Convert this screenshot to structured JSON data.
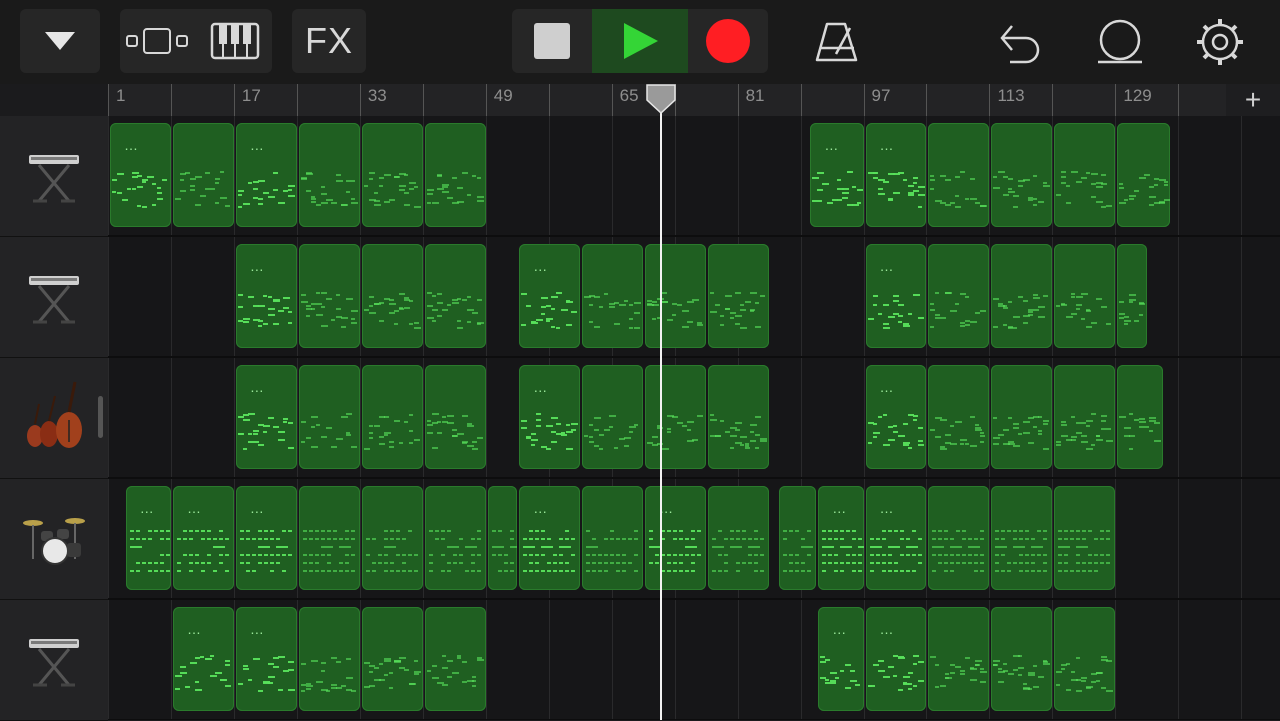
{
  "toolbar": {
    "tracks_menu_icon": "triangle-down-icon",
    "view_toggle_icon": "tracks-view-icon",
    "instrument_icon": "piano-keyboard-icon",
    "fx_label": "FX",
    "transport": {
      "stop_icon": "stop-icon",
      "play_icon": "play-icon",
      "record_icon": "record-icon"
    },
    "metronome_icon": "metronome-icon",
    "undo_icon": "undo-icon",
    "loop_icon": "loop-browser-icon",
    "settings_icon": "settings-gear-icon"
  },
  "ruler": {
    "labels": [
      "1",
      "17",
      "33",
      "49",
      "65",
      "81",
      "97",
      "113",
      "129"
    ],
    "add_label": "+"
  },
  "playhead_bar": 71,
  "colors": {
    "region": "#1f5f21",
    "note": "#59e25c",
    "accent_play": "#34d536",
    "record": "#ff1e23"
  },
  "tracks": [
    {
      "name": "keyboard",
      "icon": "keyboard-stand-icon",
      "regions": [
        {
          "label": "…",
          "start": 1,
          "end": 9
        },
        {
          "label": "",
          "start": 9,
          "end": 17
        },
        {
          "label": "…",
          "start": 17,
          "end": 25
        },
        {
          "label": "",
          "start": 25,
          "end": 33
        },
        {
          "label": "",
          "start": 33,
          "end": 41
        },
        {
          "label": "",
          "start": 41,
          "end": 49
        },
        {
          "label": "…",
          "start": 90,
          "end": 97
        },
        {
          "label": "…",
          "start": 97,
          "end": 105
        },
        {
          "label": "",
          "start": 105,
          "end": 113
        },
        {
          "label": "",
          "start": 113,
          "end": 121
        },
        {
          "label": "",
          "start": 121,
          "end": 129
        },
        {
          "label": "",
          "start": 129,
          "end": 136
        }
      ]
    },
    {
      "name": "keyboard-2",
      "icon": "keyboard-stand-icon",
      "regions": [
        {
          "label": "…",
          "start": 17,
          "end": 25
        },
        {
          "label": "",
          "start": 25,
          "end": 33
        },
        {
          "label": "",
          "start": 33,
          "end": 41
        },
        {
          "label": "",
          "start": 41,
          "end": 49
        },
        {
          "label": "…",
          "start": 53,
          "end": 61
        },
        {
          "label": "",
          "start": 61,
          "end": 69
        },
        {
          "label": "",
          "start": 69,
          "end": 77
        },
        {
          "label": "",
          "start": 77,
          "end": 85
        },
        {
          "label": "…",
          "start": 97,
          "end": 105
        },
        {
          "label": "",
          "start": 105,
          "end": 113
        },
        {
          "label": "",
          "start": 113,
          "end": 121
        },
        {
          "label": "",
          "start": 121,
          "end": 129
        },
        {
          "label": "",
          "start": 129,
          "end": 133
        }
      ]
    },
    {
      "name": "strings",
      "icon": "string-ensemble-icon",
      "regions": [
        {
          "label": "…",
          "start": 17,
          "end": 25
        },
        {
          "label": "",
          "start": 25,
          "end": 33
        },
        {
          "label": "",
          "start": 33,
          "end": 41
        },
        {
          "label": "",
          "start": 41,
          "end": 49
        },
        {
          "label": "…",
          "start": 53,
          "end": 61
        },
        {
          "label": "",
          "start": 61,
          "end": 69
        },
        {
          "label": "",
          "start": 69,
          "end": 77
        },
        {
          "label": "",
          "start": 77,
          "end": 85
        },
        {
          "label": "…",
          "start": 97,
          "end": 105
        },
        {
          "label": "",
          "start": 105,
          "end": 113
        },
        {
          "label": "",
          "start": 113,
          "end": 121
        },
        {
          "label": "",
          "start": 121,
          "end": 129
        },
        {
          "label": "",
          "start": 129,
          "end": 135
        }
      ]
    },
    {
      "name": "drums",
      "icon": "drum-kit-icon",
      "regions": [
        {
          "label": "…",
          "start": 3,
          "end": 9
        },
        {
          "label": "…",
          "start": 9,
          "end": 17
        },
        {
          "label": "…",
          "start": 17,
          "end": 25
        },
        {
          "label": "",
          "start": 25,
          "end": 33
        },
        {
          "label": "",
          "start": 33,
          "end": 41
        },
        {
          "label": "",
          "start": 41,
          "end": 49
        },
        {
          "label": "",
          "start": 49,
          "end": 53
        },
        {
          "label": "…",
          "start": 53,
          "end": 61
        },
        {
          "label": "",
          "start": 61,
          "end": 69
        },
        {
          "label": "…",
          "start": 69,
          "end": 77
        },
        {
          "label": "",
          "start": 77,
          "end": 85
        },
        {
          "label": "",
          "start": 86,
          "end": 91
        },
        {
          "label": "…",
          "start": 91,
          "end": 97
        },
        {
          "label": "…",
          "start": 97,
          "end": 105
        },
        {
          "label": "",
          "start": 105,
          "end": 113
        },
        {
          "label": "",
          "start": 113,
          "end": 121
        },
        {
          "label": "",
          "start": 121,
          "end": 129
        }
      ]
    },
    {
      "name": "synth",
      "icon": "keyboard-stand-icon",
      "regions": [
        {
          "label": "…",
          "start": 9,
          "end": 17
        },
        {
          "label": "…",
          "start": 17,
          "end": 25
        },
        {
          "label": "",
          "start": 25,
          "end": 33
        },
        {
          "label": "",
          "start": 33,
          "end": 41
        },
        {
          "label": "",
          "start": 41,
          "end": 49
        },
        {
          "label": "…",
          "start": 91,
          "end": 97
        },
        {
          "label": "…",
          "start": 97,
          "end": 105
        },
        {
          "label": "",
          "start": 105,
          "end": 113
        },
        {
          "label": "",
          "start": 113,
          "end": 121
        },
        {
          "label": "",
          "start": 121,
          "end": 129
        }
      ]
    }
  ]
}
